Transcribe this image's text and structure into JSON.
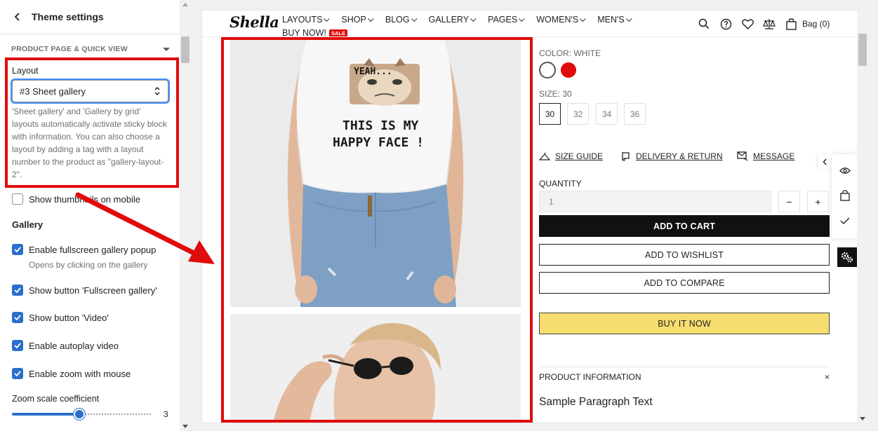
{
  "sidebar": {
    "title": "Theme settings",
    "section_label": "PRODUCT PAGE & QUICK VIEW",
    "layout_label": "Layout",
    "layout_value": "#3 Sheet gallery",
    "layout_help": "'Sheet gallery' and 'Gallery by grid' layouts automatically activate sticky block with information. You can also choose a layout by adding a tag with a layout number to the product as \"gallery-layout-2\".",
    "show_thumbnails": {
      "label": "Show thumbnails on mobile",
      "checked": false
    },
    "gallery_heading": "Gallery",
    "checkboxes": [
      {
        "label": "Enable fullscreen gallery popup",
        "sub": "Opens by clicking on the gallery",
        "checked": true
      },
      {
        "label": "Show button 'Fullscreen gallery'",
        "checked": true
      },
      {
        "label": "Show button 'Video'",
        "checked": true
      },
      {
        "label": "Enable autoplay video",
        "checked": true
      },
      {
        "label": "Enable zoom with mouse",
        "checked": true
      }
    ],
    "zoom_label": "Zoom scale coefficient",
    "zoom_value": "3",
    "zoom_fraction": 0.48
  },
  "store": {
    "logo": "Shella",
    "nav": [
      {
        "label": "LAYOUTS",
        "has_menu": true
      },
      {
        "label": "SHOP",
        "has_menu": true
      },
      {
        "label": "BLOG",
        "has_menu": true
      },
      {
        "label": "GALLERY",
        "has_menu": true
      },
      {
        "label": "PAGES",
        "has_menu": true
      },
      {
        "label": "WOMEN'S",
        "has_menu": true
      },
      {
        "label": "MEN'S",
        "has_menu": true
      }
    ],
    "buy_now": "BUY NOW!",
    "sale_badge": "SALE",
    "bag_label": "Bag (0)",
    "header_icons": [
      "search-icon",
      "help-icon",
      "heart-icon",
      "compare-icon",
      "bag-icon"
    ]
  },
  "product": {
    "tshirt_text": {
      "line1": "YEAH...",
      "line2": "THIS IS MY",
      "line3": "HAPPY FACE !"
    },
    "color_label": "COLOR:",
    "color_value": "WHITE",
    "colors": [
      "#ffffff",
      "#e00b0b"
    ],
    "size_label": "SIZE:",
    "size_value": "30",
    "sizes": [
      "30",
      "32",
      "34",
      "36"
    ],
    "links": [
      "SIZE GUIDE",
      "DELIVERY & RETURN",
      "MESSAGE"
    ],
    "quantity_label": "QUANTITY",
    "quantity_value": "1",
    "minus": "−",
    "plus": "+",
    "add_to_cart": "ADD TO CART",
    "add_to_wishlist": "ADD TO WISHLIST",
    "add_to_compare": "ADD TO COMPARE",
    "buy_it_now": "BUY IT NOW",
    "info_heading": "PRODUCT INFORMATION",
    "info_close": "×",
    "info_text": "Sample Paragraph Text"
  },
  "colors": {
    "annotation_red": "#e00b0b",
    "accent_blue": "#2c6ecb",
    "buy_yellow": "#f7dd6d"
  }
}
